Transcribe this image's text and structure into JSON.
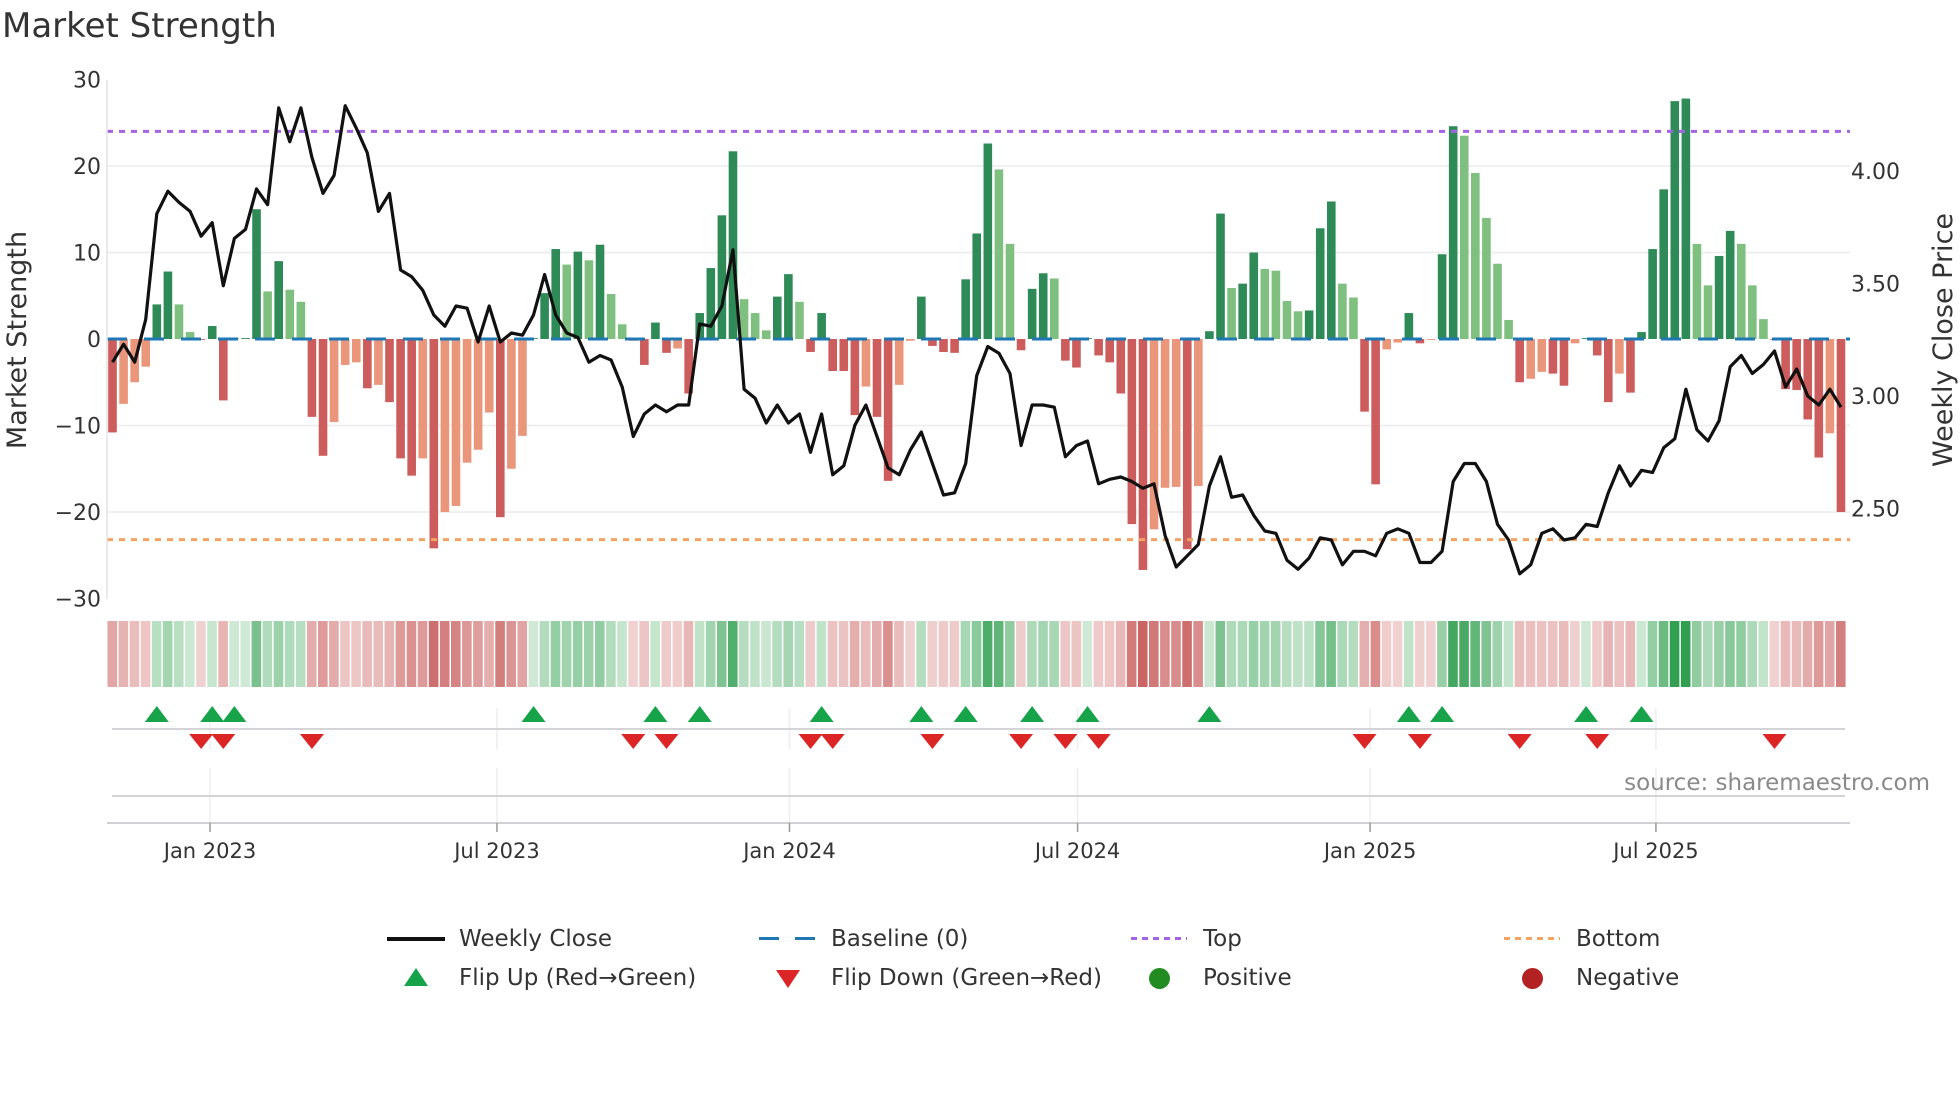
{
  "title": "Market Strength",
  "source": "source: sharemaestro.com",
  "chart_data": {
    "type": "bar",
    "title": "Market Strength",
    "ylabel": "Market Strength",
    "y2label": "Weekly Close Price",
    "ylim": [
      -30,
      30
    ],
    "y2lim": [
      2.098,
      4.404
    ],
    "yticks": [
      30,
      20,
      10,
      0,
      -10,
      -20,
      -30
    ],
    "y2ticks": [
      4.0,
      3.5,
      3.0,
      2.5
    ],
    "y2tick_labels": [
      "4.00",
      "3.50",
      "3.00",
      "2.50"
    ],
    "top_line": 24,
    "bottom_line": -23.2,
    "baseline": 0,
    "xticks": [
      {
        "label": "Jan 2023",
        "week": 8.8
      },
      {
        "label": "Jul 2023",
        "week": 34.7
      },
      {
        "label": "Jan 2024",
        "week": 61.1
      },
      {
        "label": "Jul 2024",
        "week": 87.1
      },
      {
        "label": "Jan 2025",
        "week": 113.5
      },
      {
        "label": "Jul 2025",
        "week": 139.3
      }
    ],
    "strength": [
      -10.8,
      -7.5,
      -5,
      -3.2,
      4,
      7.8,
      4,
      0.8,
      -0.1,
      1.5,
      -7.1,
      0.1,
      0.1,
      15,
      5.5,
      9,
      5.7,
      4.3,
      -9,
      -13.5,
      -9.6,
      -3,
      -2.7,
      -5.7,
      -5.3,
      -7.3,
      -13.8,
      -15.8,
      -13.8,
      -24.2,
      -20,
      -19.3,
      -14.3,
      -12.8,
      -8.5,
      -20.6,
      -15,
      -11.2,
      0.1,
      5.3,
      10.4,
      8.6,
      10.1,
      9.1,
      10.9,
      5.2,
      1.7,
      -0.2,
      -3,
      1.9,
      -1.6,
      -1.1,
      -6.3,
      3,
      8.2,
      14.3,
      21.7,
      4.6,
      3,
      1,
      4.9,
      7.5,
      4.3,
      -1.5,
      3,
      -3.7,
      -3.7,
      -8.8,
      -5.5,
      -9,
      -16.4,
      -5.3,
      -0.2,
      4.9,
      -0.8,
      -1.5,
      -1.6,
      6.9,
      12.2,
      22.6,
      19.6,
      11,
      -1.3,
      5.8,
      7.6,
      7,
      -2.5,
      -3.3,
      0.1,
      -1.9,
      -2.7,
      -6.3,
      -21.4,
      -26.7,
      -22,
      -17.2,
      -17.1,
      -24.3,
      -17,
      0.9,
      14.5,
      5.9,
      6.4,
      10,
      8.1,
      7.9,
      4.4,
      3.2,
      3.3,
      12.8,
      15.9,
      6.4,
      4.8,
      -8.4,
      -16.8,
      -1.2,
      -0.4,
      3,
      -0.5,
      -0.1,
      9.8,
      24.6,
      23.5,
      19.2,
      14,
      8.7,
      2.2,
      -5,
      -4.6,
      -3.8,
      -4,
      -5.4,
      -0.5,
      0.1,
      -1.9,
      -7.3,
      -4,
      -6.2,
      0.8,
      10.4,
      17.3,
      27.5,
      27.8,
      11,
      6.2,
      9.6,
      12.5,
      11,
      6.2,
      2.3,
      -0.1,
      -5.8,
      -5.9,
      -9.3,
      -13.7,
      -10.9,
      -20
    ],
    "weekly_close": [
      3.15,
      3.23,
      3.15,
      3.34,
      3.81,
      3.91,
      3.86,
      3.82,
      3.71,
      3.77,
      3.49,
      3.7,
      3.74,
      3.92,
      3.85,
      4.28,
      4.13,
      4.28,
      4.06,
      3.9,
      3.98,
      4.29,
      4.19,
      4.08,
      3.82,
      3.9,
      3.56,
      3.53,
      3.47,
      3.36,
      3.31,
      3.4,
      3.39,
      3.24,
      3.4,
      3.24,
      3.28,
      3.27,
      3.36,
      3.54,
      3.36,
      3.28,
      3.26,
      3.15,
      3.18,
      3.16,
      3.04,
      2.82,
      2.92,
      2.96,
      2.93,
      2.96,
      2.96,
      3.32,
      3.31,
      3.4,
      3.65,
      3.03,
      2.99,
      2.88,
      2.96,
      2.88,
      2.92,
      2.75,
      2.92,
      2.65,
      2.69,
      2.87,
      2.96,
      2.82,
      2.68,
      2.65,
      2.76,
      2.84,
      2.7,
      2.56,
      2.57,
      2.7,
      3.09,
      3.22,
      3.19,
      3.1,
      2.78,
      2.96,
      2.96,
      2.95,
      2.73,
      2.78,
      2.8,
      2.61,
      2.63,
      2.64,
      2.62,
      2.59,
      2.61,
      2.38,
      2.24,
      2.29,
      2.34,
      2.6,
      2.73,
      2.55,
      2.56,
      2.47,
      2.4,
      2.39,
      2.27,
      2.23,
      2.28,
      2.37,
      2.36,
      2.25,
      2.31,
      2.31,
      2.29,
      2.39,
      2.41,
      2.39,
      2.26,
      2.26,
      2.31,
      2.62,
      2.7,
      2.7,
      2.62,
      2.43,
      2.36,
      2.21,
      2.25,
      2.39,
      2.41,
      2.36,
      2.37,
      2.43,
      2.42,
      2.57,
      2.69,
      2.6,
      2.67,
      2.66,
      2.77,
      2.81,
      3.03,
      2.85,
      2.8,
      2.89,
      3.13,
      3.18,
      3.1,
      3.14,
      3.2,
      3.04,
      3.12,
      3.0,
      2.96,
      3.03,
      2.95
    ],
    "flip_up_weeks": [
      4,
      9,
      11,
      38,
      49,
      53,
      64,
      73,
      77,
      83,
      88,
      99,
      117,
      120,
      133,
      138
    ],
    "flip_down_weeks": [
      8,
      10,
      18,
      47,
      50,
      63,
      65,
      74,
      82,
      86,
      89,
      113,
      118,
      127,
      134,
      150
    ],
    "legend": {
      "weekly_close": "Weekly Close",
      "baseline": "Baseline (0)",
      "top": "Top",
      "bottom": "Bottom",
      "flip_up": "Flip Up (Red→Green)",
      "flip_down": "Flip Down (Green→Red)",
      "positive": "Positive",
      "negative": "Negative"
    },
    "legend_position": "bottom"
  },
  "colors": {
    "pos_strong": "#2e8b57",
    "pos_weak": "#7fbf7f",
    "neg_strong": "#cd5c5c",
    "neg_weak": "#e9967a",
    "line": "#111111",
    "baseline": "#1f77b4",
    "top": "#a463e6",
    "bottom": "#f4a460",
    "flip_up": "#16a34a",
    "flip_down": "#dc2626",
    "positive": "#228b22",
    "negative": "#b22222"
  }
}
